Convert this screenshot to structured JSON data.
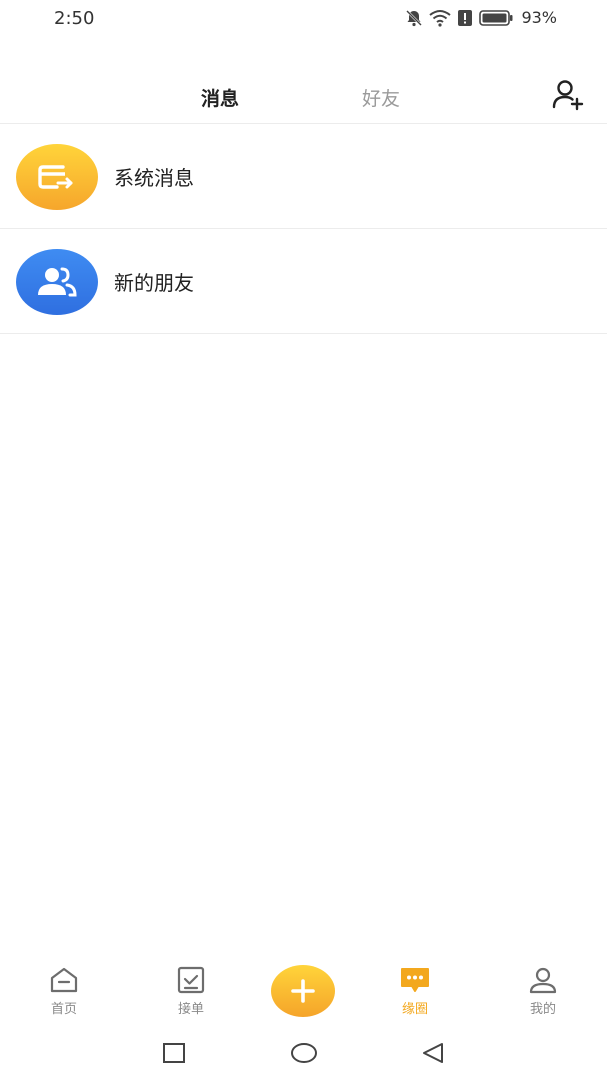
{
  "status_bar": {
    "time": "2:50",
    "battery": "93%"
  },
  "header": {
    "tabs": [
      {
        "label": "消息",
        "active": true
      },
      {
        "label": "好友",
        "active": false
      }
    ]
  },
  "list": {
    "items": [
      {
        "label": "系统消息",
        "icon": "system-message-icon"
      },
      {
        "label": "新的朋友",
        "icon": "new-friends-icon"
      }
    ]
  },
  "bottom_nav": {
    "items": [
      {
        "label": "首页",
        "icon": "home-icon"
      },
      {
        "label": "接单",
        "icon": "orders-icon"
      },
      {
        "label": "缘圈",
        "icon": "chat-circle-icon",
        "active": true
      },
      {
        "label": "我的",
        "icon": "profile-icon"
      }
    ]
  },
  "colors": {
    "accent": "#f3a81e",
    "blue": "#2f6fe0"
  }
}
